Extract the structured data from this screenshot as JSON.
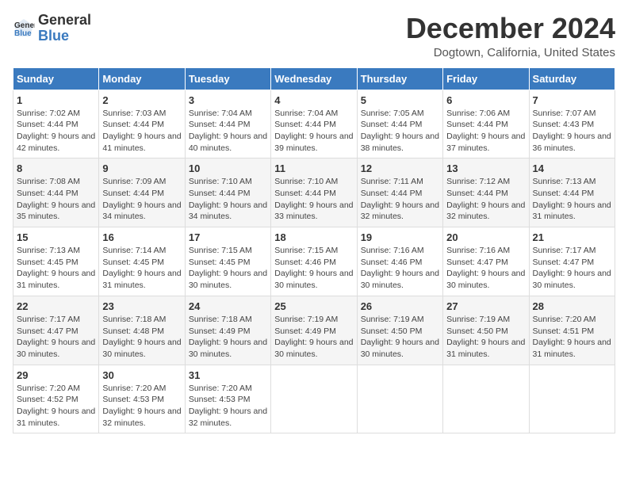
{
  "header": {
    "logo_line1": "General",
    "logo_line2": "Blue",
    "month_title": "December 2024",
    "location": "Dogtown, California, United States"
  },
  "weekdays": [
    "Sunday",
    "Monday",
    "Tuesday",
    "Wednesday",
    "Thursday",
    "Friday",
    "Saturday"
  ],
  "weeks": [
    [
      {
        "day": "1",
        "sunrise": "7:02 AM",
        "sunset": "4:44 PM",
        "daylight": "9 hours and 42 minutes."
      },
      {
        "day": "2",
        "sunrise": "7:03 AM",
        "sunset": "4:44 PM",
        "daylight": "9 hours and 41 minutes."
      },
      {
        "day": "3",
        "sunrise": "7:04 AM",
        "sunset": "4:44 PM",
        "daylight": "9 hours and 40 minutes."
      },
      {
        "day": "4",
        "sunrise": "7:04 AM",
        "sunset": "4:44 PM",
        "daylight": "9 hours and 39 minutes."
      },
      {
        "day": "5",
        "sunrise": "7:05 AM",
        "sunset": "4:44 PM",
        "daylight": "9 hours and 38 minutes."
      },
      {
        "day": "6",
        "sunrise": "7:06 AM",
        "sunset": "4:44 PM",
        "daylight": "9 hours and 37 minutes."
      },
      {
        "day": "7",
        "sunrise": "7:07 AM",
        "sunset": "4:43 PM",
        "daylight": "9 hours and 36 minutes."
      }
    ],
    [
      {
        "day": "8",
        "sunrise": "7:08 AM",
        "sunset": "4:44 PM",
        "daylight": "9 hours and 35 minutes."
      },
      {
        "day": "9",
        "sunrise": "7:09 AM",
        "sunset": "4:44 PM",
        "daylight": "9 hours and 34 minutes."
      },
      {
        "day": "10",
        "sunrise": "7:10 AM",
        "sunset": "4:44 PM",
        "daylight": "9 hours and 34 minutes."
      },
      {
        "day": "11",
        "sunrise": "7:10 AM",
        "sunset": "4:44 PM",
        "daylight": "9 hours and 33 minutes."
      },
      {
        "day": "12",
        "sunrise": "7:11 AM",
        "sunset": "4:44 PM",
        "daylight": "9 hours and 32 minutes."
      },
      {
        "day": "13",
        "sunrise": "7:12 AM",
        "sunset": "4:44 PM",
        "daylight": "9 hours and 32 minutes."
      },
      {
        "day": "14",
        "sunrise": "7:13 AM",
        "sunset": "4:44 PM",
        "daylight": "9 hours and 31 minutes."
      }
    ],
    [
      {
        "day": "15",
        "sunrise": "7:13 AM",
        "sunset": "4:45 PM",
        "daylight": "9 hours and 31 minutes."
      },
      {
        "day": "16",
        "sunrise": "7:14 AM",
        "sunset": "4:45 PM",
        "daylight": "9 hours and 31 minutes."
      },
      {
        "day": "17",
        "sunrise": "7:15 AM",
        "sunset": "4:45 PM",
        "daylight": "9 hours and 30 minutes."
      },
      {
        "day": "18",
        "sunrise": "7:15 AM",
        "sunset": "4:46 PM",
        "daylight": "9 hours and 30 minutes."
      },
      {
        "day": "19",
        "sunrise": "7:16 AM",
        "sunset": "4:46 PM",
        "daylight": "9 hours and 30 minutes."
      },
      {
        "day": "20",
        "sunrise": "7:16 AM",
        "sunset": "4:47 PM",
        "daylight": "9 hours and 30 minutes."
      },
      {
        "day": "21",
        "sunrise": "7:17 AM",
        "sunset": "4:47 PM",
        "daylight": "9 hours and 30 minutes."
      }
    ],
    [
      {
        "day": "22",
        "sunrise": "7:17 AM",
        "sunset": "4:47 PM",
        "daylight": "9 hours and 30 minutes."
      },
      {
        "day": "23",
        "sunrise": "7:18 AM",
        "sunset": "4:48 PM",
        "daylight": "9 hours and 30 minutes."
      },
      {
        "day": "24",
        "sunrise": "7:18 AM",
        "sunset": "4:49 PM",
        "daylight": "9 hours and 30 minutes."
      },
      {
        "day": "25",
        "sunrise": "7:19 AM",
        "sunset": "4:49 PM",
        "daylight": "9 hours and 30 minutes."
      },
      {
        "day": "26",
        "sunrise": "7:19 AM",
        "sunset": "4:50 PM",
        "daylight": "9 hours and 30 minutes."
      },
      {
        "day": "27",
        "sunrise": "7:19 AM",
        "sunset": "4:50 PM",
        "daylight": "9 hours and 31 minutes."
      },
      {
        "day": "28",
        "sunrise": "7:20 AM",
        "sunset": "4:51 PM",
        "daylight": "9 hours and 31 minutes."
      }
    ],
    [
      {
        "day": "29",
        "sunrise": "7:20 AM",
        "sunset": "4:52 PM",
        "daylight": "9 hours and 31 minutes."
      },
      {
        "day": "30",
        "sunrise": "7:20 AM",
        "sunset": "4:53 PM",
        "daylight": "9 hours and 32 minutes."
      },
      {
        "day": "31",
        "sunrise": "7:20 AM",
        "sunset": "4:53 PM",
        "daylight": "9 hours and 32 minutes."
      },
      null,
      null,
      null,
      null
    ]
  ]
}
